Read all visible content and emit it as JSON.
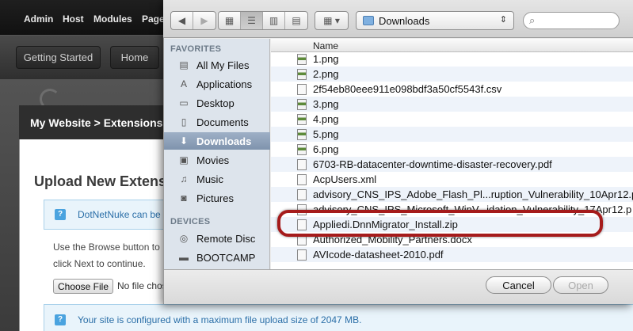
{
  "background_page": {
    "top_menu": [
      "Admin",
      "Host",
      "Modules",
      "Page"
    ],
    "nav_buttons": [
      "Getting Started",
      "Home"
    ],
    "panel_title": "My Website > Extensions",
    "upload_title": "Upload New Extension",
    "info_1": "DotNetNuke can be",
    "instruction_line_1": "Use the Browse button to",
    "instruction_line_2": "click Next to continue.",
    "choose_file_label": "Choose File",
    "no_file_text": "No file chos",
    "info_2": "Your site is configured with a maximum file upload size of 2047 MB."
  },
  "dialog": {
    "location": "Downloads",
    "sidebar": {
      "favorites_header": "FAVORITES",
      "devices_header": "DEVICES",
      "favorites": [
        {
          "label": "All My Files",
          "icon": "all-files-icon"
        },
        {
          "label": "Applications",
          "icon": "applications-icon"
        },
        {
          "label": "Desktop",
          "icon": "desktop-icon"
        },
        {
          "label": "Documents",
          "icon": "documents-icon"
        },
        {
          "label": "Downloads",
          "icon": "downloads-icon",
          "selected": true
        },
        {
          "label": "Movies",
          "icon": "movies-icon"
        },
        {
          "label": "Music",
          "icon": "music-icon"
        },
        {
          "label": "Pictures",
          "icon": "pictures-icon"
        }
      ],
      "devices": [
        {
          "label": "Remote Disc",
          "icon": "disc-icon"
        },
        {
          "label": "BOOTCAMP",
          "icon": "drive-icon"
        }
      ]
    },
    "column_header": "Name",
    "files": [
      "1.png",
      "2.png",
      "2f54eb80eee911e098bdf3a50cf5543f.csv",
      "3.png",
      "4.png",
      "5.png",
      "6.png",
      "6703-RB-datacenter-downtime-disaster-recovery.pdf",
      "AcpUsers.xml",
      "advisory_CNS_IPS_Adobe_Flash_Pl...ruption_Vulnerability_10Apr12.p",
      "advisory_CNS_IPS_Microsoft_WinV...idation_Vulnerability_17Apr12.p",
      "Appliedi.DnnMigrator_Install.zip",
      "Authorized_Mobility_Partners.docx",
      "AVIcode-datasheet-2010.pdf"
    ],
    "highlighted_file": "Appliedi.DnnMigrator_Install.zip",
    "cancel_label": "Cancel",
    "open_label": "Open"
  }
}
